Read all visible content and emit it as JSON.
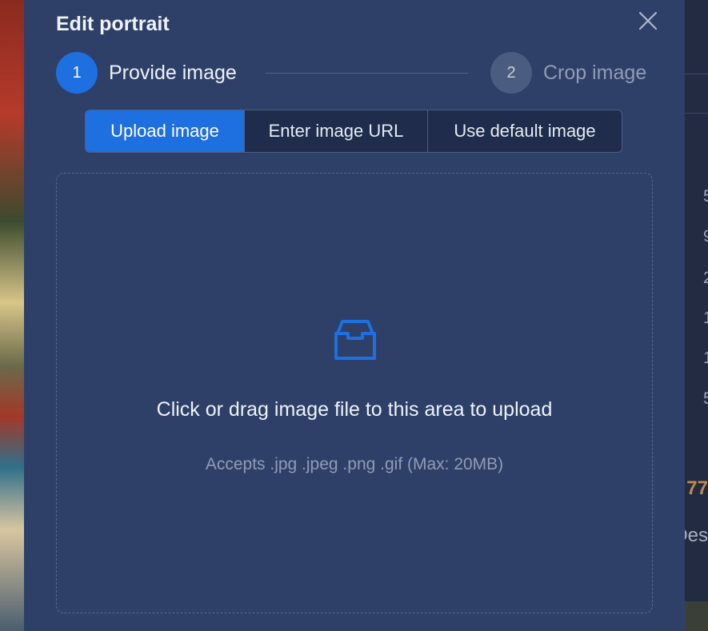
{
  "modal": {
    "title": "Edit portrait",
    "steps": [
      {
        "number": "1",
        "label": "Provide image",
        "state": "active"
      },
      {
        "number": "2",
        "label": "Crop image",
        "state": "inactive"
      }
    ],
    "source_tabs": [
      {
        "label": "Upload image",
        "selected": true
      },
      {
        "label": "Enter image URL",
        "selected": false
      },
      {
        "label": "Use default image",
        "selected": false
      }
    ],
    "dropzone": {
      "icon": "inbox-icon",
      "text": "Click or drag image file to this area to upload",
      "hint": "Accepts .jpg .jpeg .png .gif (Max: 20MB)"
    },
    "close_icon": "close-icon"
  },
  "background": {
    "partial_numbers": [
      "5",
      "9",
      "2",
      "1",
      "1",
      "5"
    ],
    "partial_highlight": "77",
    "partial_text": "Des"
  },
  "colors": {
    "modal_bg": "#2e4068",
    "accent": "#1e6fe0",
    "text_primary": "#eef2f8",
    "text_muted": "#8f9cb6"
  }
}
